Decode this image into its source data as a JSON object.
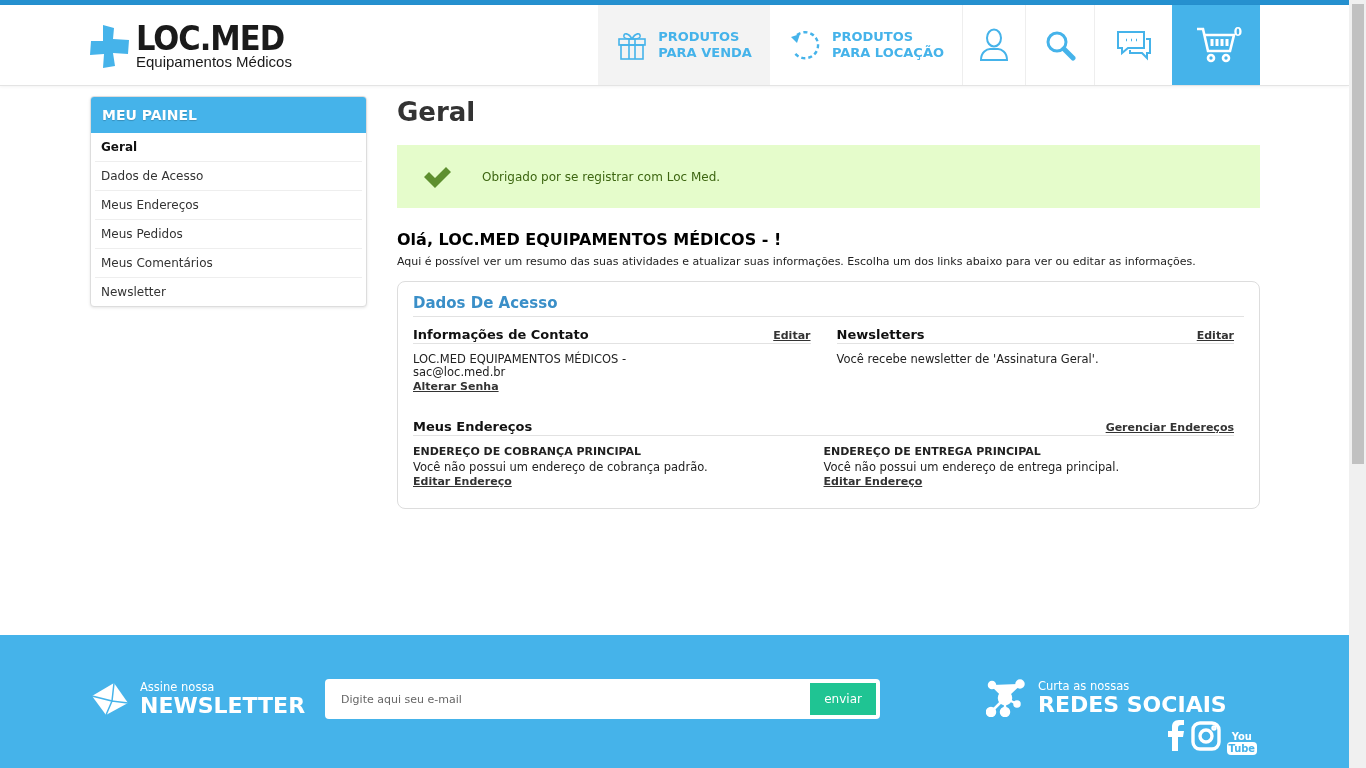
{
  "header": {
    "logo": {
      "title": "LOC.MED",
      "subtitle": "Equipamentos Médicos"
    },
    "nav": [
      {
        "kind": "gift",
        "line1": "PRODUTOS",
        "line2": "PARA VENDA",
        "selected": true
      },
      {
        "kind": "rotate",
        "line1": "PRODUTOS",
        "line2": "PARA LOCAÇÃO",
        "selected": false
      }
    ],
    "icons": [
      {
        "kind": "user"
      },
      {
        "kind": "search"
      },
      {
        "kind": "chat"
      }
    ],
    "cart": {
      "count": "0"
    }
  },
  "sidebar": {
    "title": "MEU PAINEL",
    "items": [
      {
        "label": "Geral",
        "selected": true
      },
      {
        "label": "Dados de Acesso",
        "selected": false
      },
      {
        "label": "Meus Endereços",
        "selected": false
      },
      {
        "label": "Meus Pedidos",
        "selected": false
      },
      {
        "label": "Meus Comentários",
        "selected": false
      },
      {
        "label": "Newsletter",
        "selected": false
      }
    ]
  },
  "main": {
    "title": "Geral",
    "message": "Obrigado por se registrar com Loc Med.",
    "greeting": "Olá, LOC.MED EQUIPAMENTOS MÉDICOS - !",
    "intro": "Aqui é possível ver um resumo das suas atividades e atualizar suas informações. Escolha um dos links abaixo para ver ou editar as informações.",
    "box": {
      "title": "Dados De Acesso",
      "contact": {
        "heading": "Informações de Contato",
        "action": "Editar",
        "lines": [
          "LOC.MED EQUIPAMENTOS MÉDICOS -",
          "sac@loc.med.br"
        ],
        "link": "Alterar Senha"
      },
      "newsletters": {
        "heading": "Newsletters",
        "action": "Editar",
        "text": "Você recebe newsletter de 'Assinatura Geral'."
      },
      "addresses": {
        "heading": "Meus Endereços",
        "action": "Gerenciar Endereços",
        "blocks": [
          {
            "title": "ENDEREÇO DE COBRANÇA PRINCIPAL",
            "text": "Você não possui um endereço de cobrança padrão.",
            "link": "Editar Endereço"
          },
          {
            "title": "ENDEREÇO DE ENTREGA PRINCIPAL",
            "text": "Você não possui um endereço de entrega principal.",
            "link": "Editar Endereço"
          }
        ]
      }
    }
  },
  "footer": {
    "newsletter": {
      "small": "Assine nossa",
      "big": "NEWSLETTER",
      "placeholder": "Digite aqui seu e-mail",
      "button": "enviar"
    },
    "social": {
      "small": "Curta as nossas",
      "big": "REDES SOCIAIS",
      "links": [
        {
          "kind": "facebook"
        },
        {
          "kind": "instagram"
        },
        {
          "kind": "youtube",
          "top": "You",
          "bottom": "Tube"
        }
      ]
    }
  }
}
